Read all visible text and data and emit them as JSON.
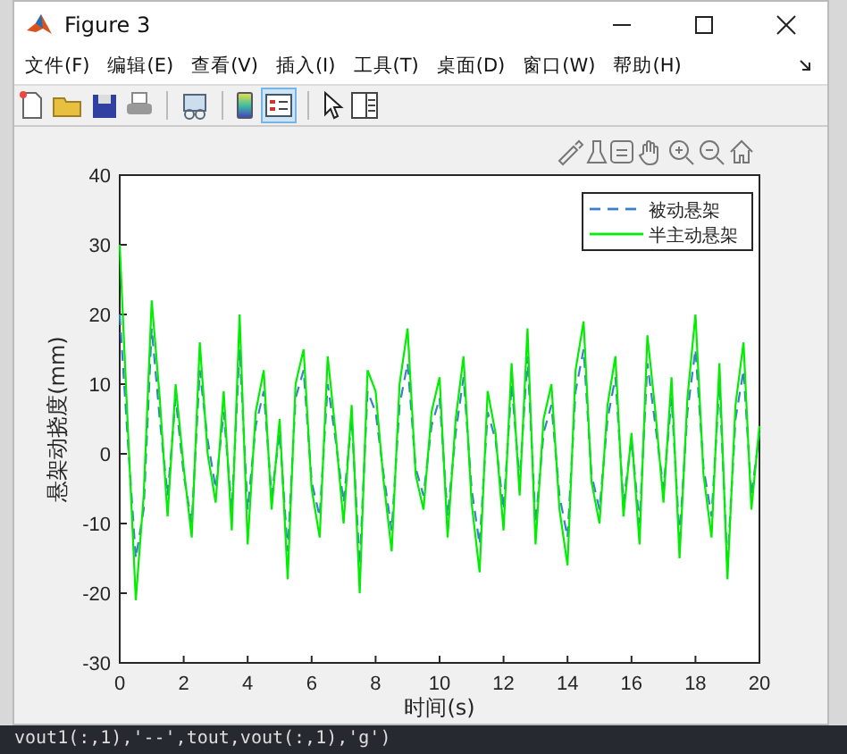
{
  "window": {
    "title": "Figure 3"
  },
  "menu": [
    "文件(F)",
    "编辑(E)",
    "查看(V)",
    "插入(I)",
    "工具(T)",
    "桌面(D)",
    "窗口(W)",
    "帮助(H)"
  ],
  "toolbar": {
    "legend_on": true
  },
  "chart_data": {
    "type": "line",
    "legend": true,
    "xlabel": "时间(s)",
    "ylabel": "悬架动挠度(mm)",
    "xlim": [
      0,
      20
    ],
    "ylim": [
      -30,
      40
    ],
    "xticks": [
      0,
      2,
      4,
      6,
      8,
      10,
      12,
      14,
      16,
      18,
      20
    ],
    "yticks": [
      -30,
      -20,
      -10,
      0,
      10,
      20,
      30,
      40
    ],
    "x": [
      0,
      0.25,
      0.5,
      0.75,
      1,
      1.25,
      1.5,
      1.75,
      2,
      2.25,
      2.5,
      2.75,
      3,
      3.25,
      3.5,
      3.75,
      4,
      4.25,
      4.5,
      4.75,
      5,
      5.25,
      5.5,
      5.75,
      6,
      6.25,
      6.5,
      6.75,
      7,
      7.25,
      7.5,
      7.75,
      8,
      8.25,
      8.5,
      8.75,
      9,
      9.25,
      9.5,
      9.75,
      10,
      10.25,
      10.5,
      10.75,
      11,
      11.25,
      11.5,
      11.75,
      12,
      12.25,
      12.5,
      12.75,
      13,
      13.25,
      13.5,
      13.75,
      14,
      14.25,
      14.5,
      14.75,
      15,
      15.25,
      15.5,
      15.75,
      16,
      16.25,
      16.5,
      16.75,
      17,
      17.25,
      17.5,
      17.75,
      18,
      18.25,
      18.5,
      18.75,
      19,
      19.25,
      19.5,
      19.75,
      20
    ],
    "series": [
      {
        "name": "被动悬架",
        "color": "#3a7fc8",
        "line_style": "dashed",
        "values": [
          20,
          2,
          -15,
          -8,
          18,
          5,
          -6,
          8,
          -3,
          -10,
          12,
          2,
          -5,
          6,
          -8,
          15,
          -8,
          4,
          9,
          -6,
          3,
          -14,
          8,
          12,
          -4,
          -9,
          10,
          2,
          -7,
          5,
          -16,
          9,
          6,
          -3,
          -11,
          7,
          13,
          -2,
          -6,
          4,
          8,
          -9,
          3,
          11,
          -5,
          -13,
          6,
          2,
          -8,
          10,
          -4,
          14,
          -10,
          3,
          7,
          -6,
          -12,
          9,
          15,
          -3,
          -8,
          5,
          11,
          -7,
          2,
          -10,
          13,
          4,
          -5,
          8,
          -12,
          6,
          15,
          -2,
          -9,
          10,
          -16,
          5,
          12,
          -6,
          3
        ]
      },
      {
        "name": "半主动悬架",
        "color": "#00ee00",
        "line_style": "solid",
        "values": [
          30,
          4,
          -21,
          -6,
          22,
          8,
          -9,
          10,
          -2,
          -12,
          16,
          0,
          -7,
          9,
          -11,
          20,
          -13,
          6,
          12,
          -8,
          5,
          -18,
          10,
          15,
          -5,
          -12,
          14,
          3,
          -10,
          7,
          -20,
          12,
          9,
          -4,
          -14,
          10,
          18,
          -3,
          -8,
          6,
          11,
          -12,
          5,
          14,
          -7,
          -17,
          9,
          3,
          -11,
          13,
          -6,
          18,
          -13,
          5,
          10,
          -8,
          -16,
          12,
          19,
          -4,
          -10,
          7,
          14,
          -9,
          3,
          -13,
          17,
          6,
          -7,
          11,
          -15,
          8,
          20,
          -3,
          -12,
          13,
          -18,
          7,
          16,
          -8,
          4
        ]
      }
    ]
  },
  "console_line": "vout1(:,1),'--',tout,vout(:,1),'g')"
}
